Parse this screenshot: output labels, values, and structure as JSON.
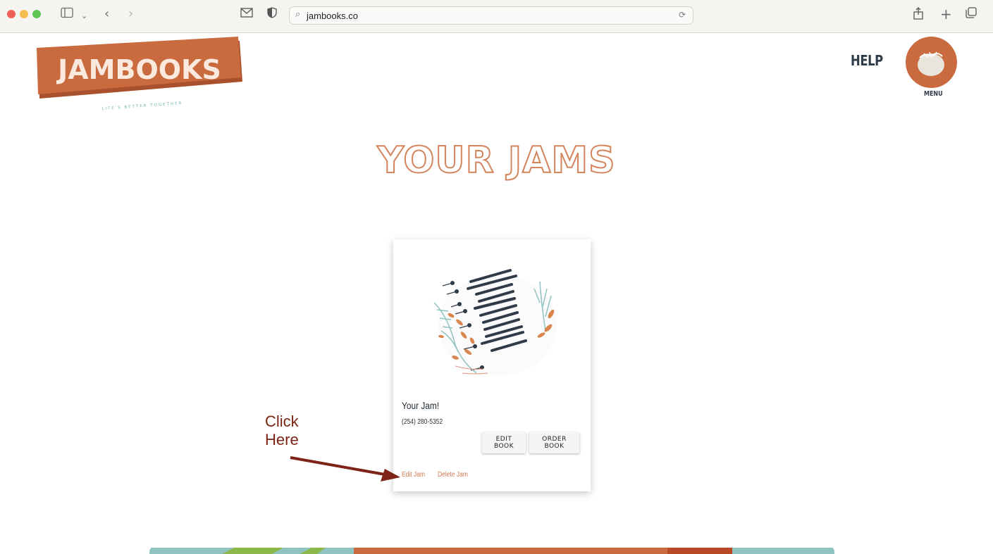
{
  "browser": {
    "url": "jambooks.co"
  },
  "header": {
    "logo_text": "JAMBOOKS",
    "logo_tagline": "LIFE'S BETTER TOGETHER",
    "help_label": "HELP",
    "menu_label": "MENU"
  },
  "page": {
    "title": "YOUR JAMS"
  },
  "card": {
    "title": "Your Jam!",
    "phone": "(254) 280-5352",
    "edit_book_label": "EDIT BOOK",
    "order_book_label": "ORDER BOOK",
    "edit_jam_label": "Edit Jam",
    "delete_jam_label": "Delete Jam"
  },
  "annotation": {
    "line1": "Click",
    "line2": "Here"
  },
  "colors": {
    "brand": "#c96a3f",
    "heading_outline": "#d3845c",
    "navy": "#2f3b49",
    "annotation": "#7d2416"
  }
}
